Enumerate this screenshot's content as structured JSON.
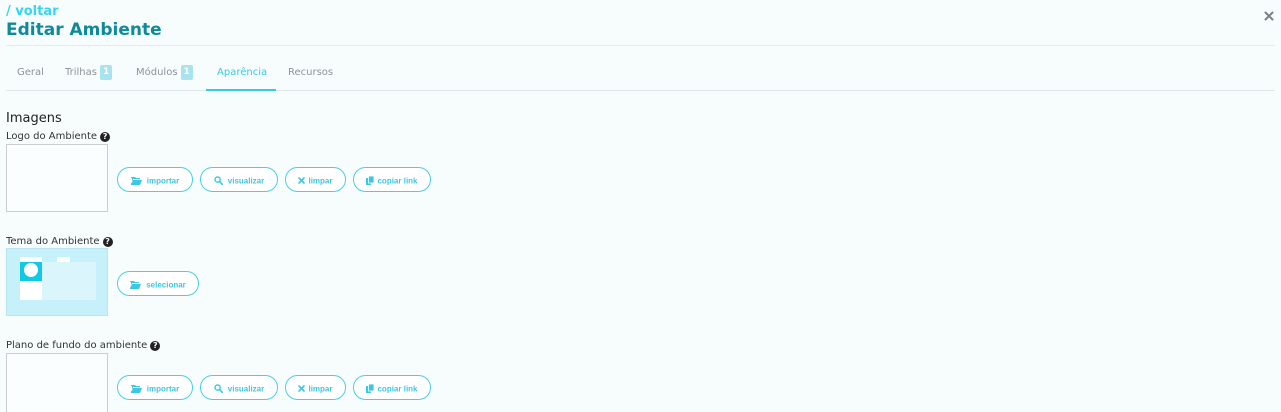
{
  "header": {
    "back_label": "/ voltar",
    "title": "Editar Ambiente",
    "close_icon": "close-icon"
  },
  "tabs": [
    {
      "label": "Geral",
      "count": null,
      "active": false
    },
    {
      "label": "Trilhas",
      "count": "1",
      "active": false
    },
    {
      "label": "Módulos",
      "count": "1",
      "active": false
    },
    {
      "label": "Aparência",
      "count": null,
      "active": true
    },
    {
      "label": "Recursos",
      "count": null,
      "active": false
    }
  ],
  "section": {
    "title": "Imagens",
    "logo": {
      "label": "Logo do Ambiente",
      "buttons": {
        "import": "importar",
        "view": "visualizar",
        "clear": "limpar",
        "copy": "copiar link"
      }
    },
    "theme": {
      "label": "Tema do Ambiente",
      "select": "selecionar"
    },
    "background": {
      "label": "Plano de fundo do ambiente",
      "buttons": {
        "import": "importar",
        "view": "visualizar",
        "clear": "limpar",
        "copy": "copiar link"
      }
    }
  },
  "colors": {
    "accent": "#35cbe6",
    "title": "#0f8a98",
    "background": "#f7fcfd",
    "theme_preview": "#c7f1fa"
  }
}
